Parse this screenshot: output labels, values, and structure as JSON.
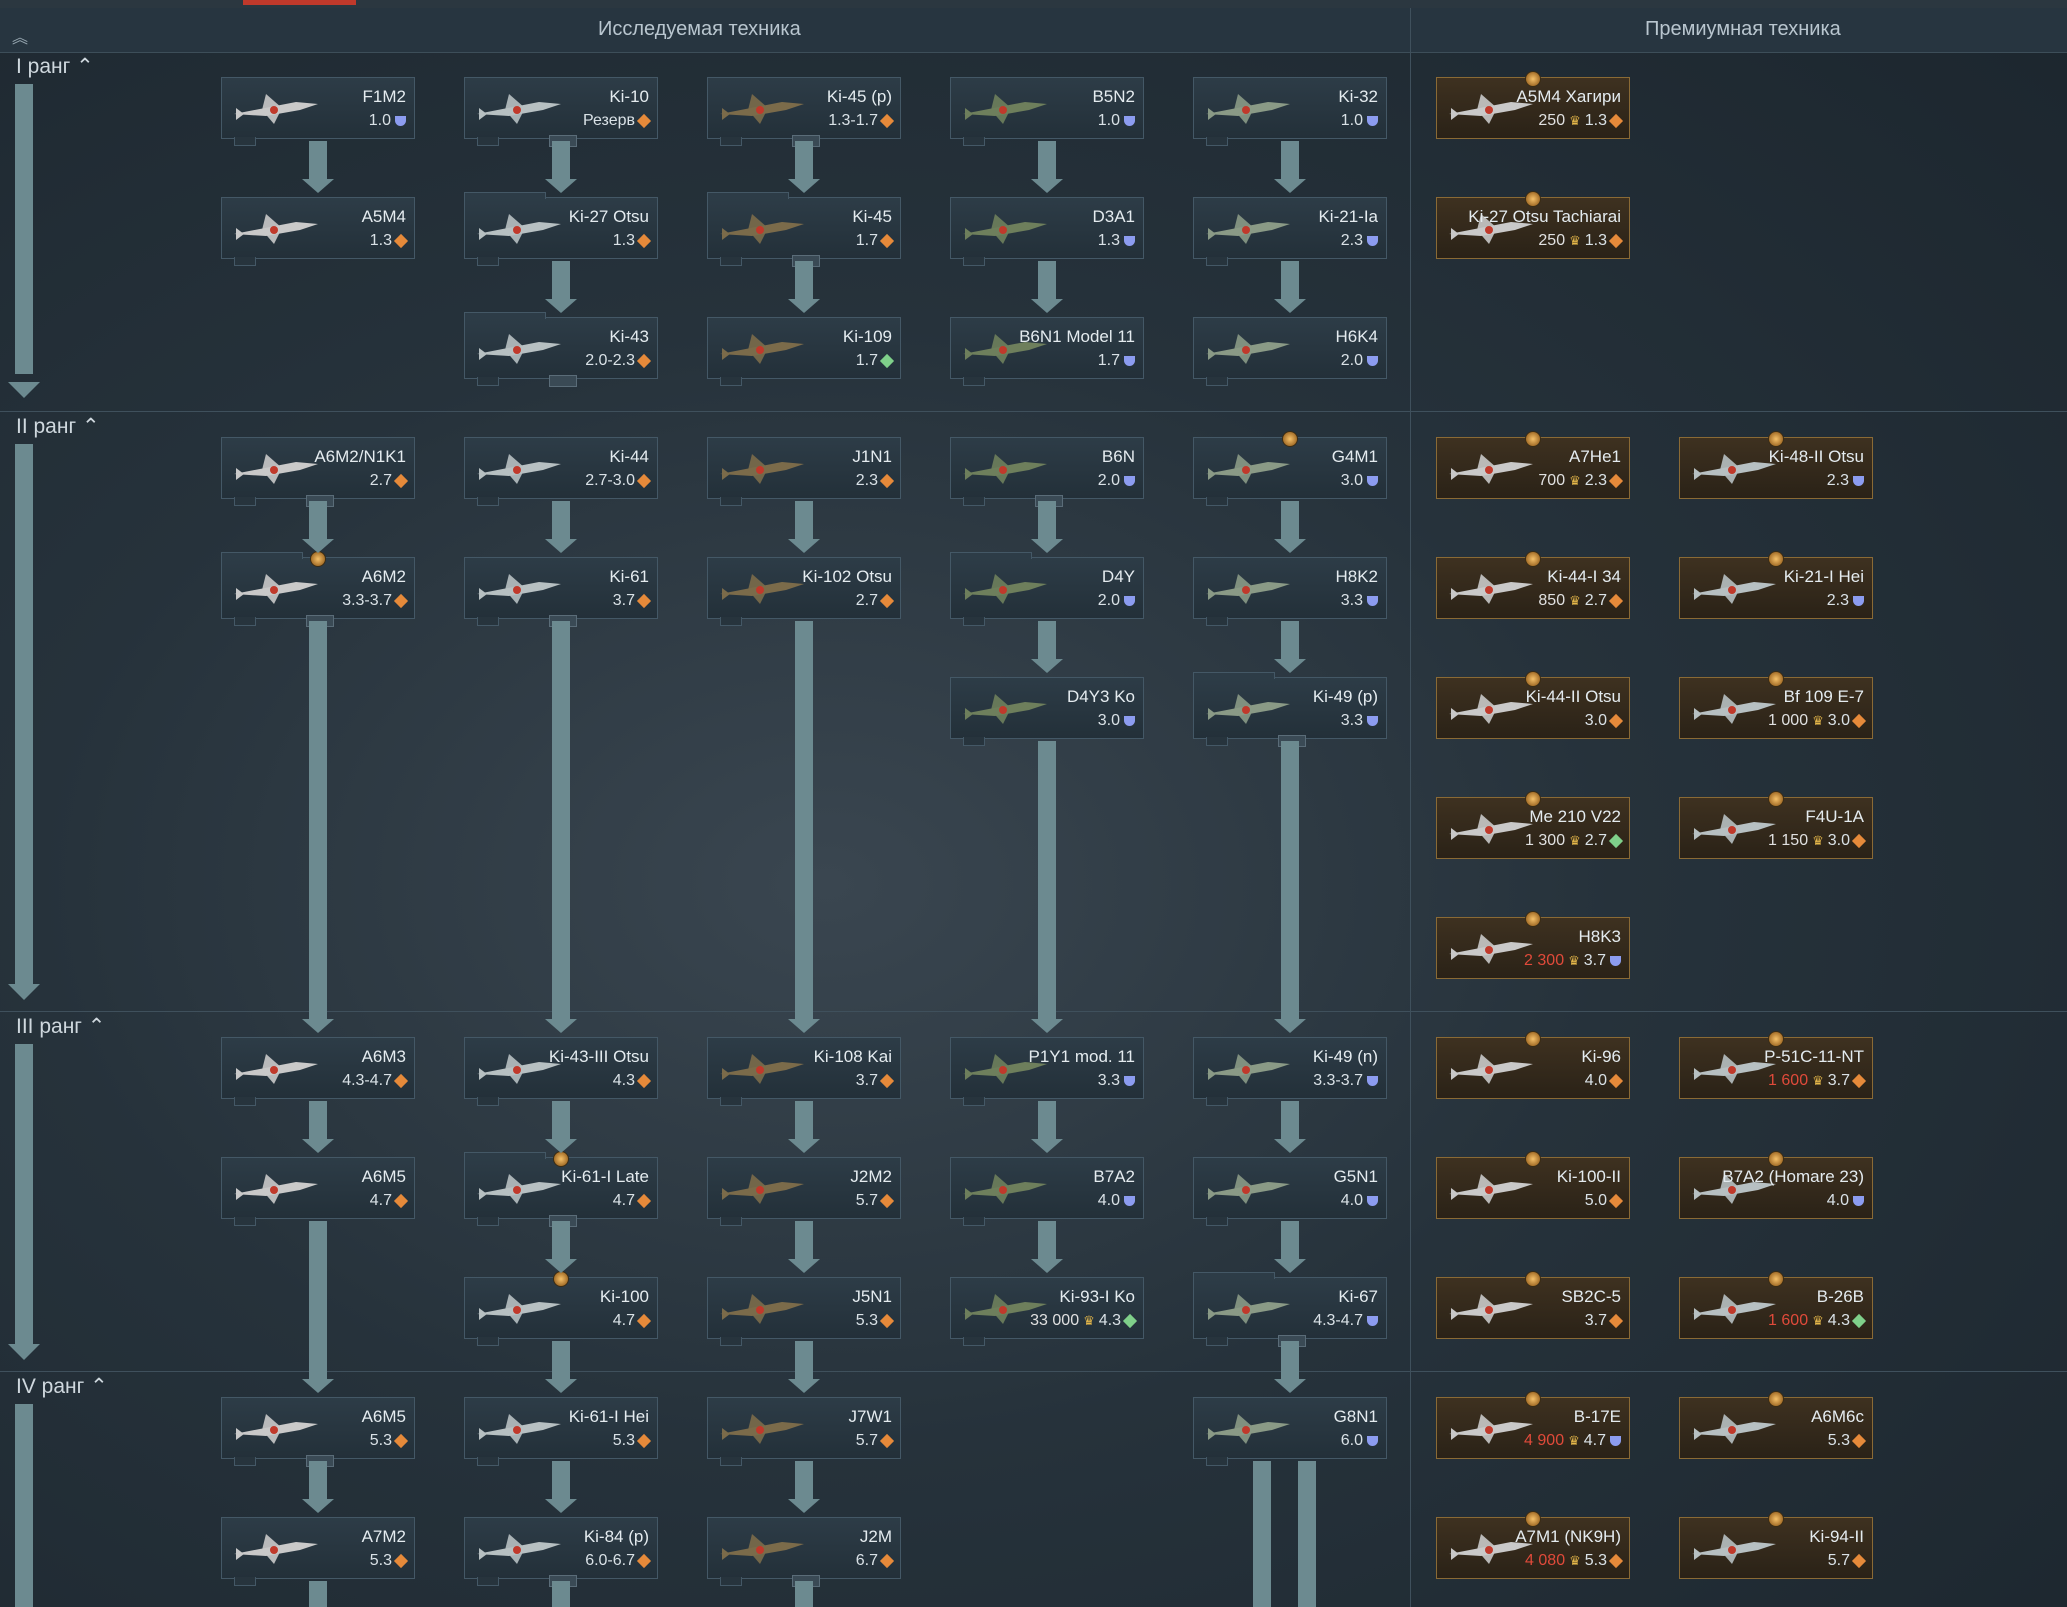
{
  "header": {
    "researchable_title": "Исследуемая техника",
    "premium_title": "Премиумная техника"
  },
  "ranks": [
    {
      "label": "I ранг"
    },
    {
      "label": "II ранг"
    },
    {
      "label": "III ранг"
    },
    {
      "label": "IV ранг"
    }
  ],
  "cards": {
    "r1": [
      {
        "name": "F1M2",
        "br": "1.0",
        "mark": "blue"
      },
      {
        "name": "Ki-10",
        "br": "Резерв",
        "mark": "air"
      },
      {
        "name": "Ki-45 (p)",
        "br": "1.3-1.7",
        "mark": "air"
      },
      {
        "name": "B5N2",
        "br": "1.0",
        "mark": "blue"
      },
      {
        "name": "Ki-32",
        "br": "1.0",
        "mark": "blue"
      },
      {
        "name": "A5M4",
        "br": "1.3",
        "mark": "air"
      },
      {
        "name": "Ki-27 Otsu",
        "br": "1.3",
        "mark": "air"
      },
      {
        "name": "Ki-45",
        "br": "1.7",
        "mark": "air"
      },
      {
        "name": "D3A1",
        "br": "1.3",
        "mark": "blue"
      },
      {
        "name": "Ki-21-Ia",
        "br": "2.3",
        "mark": "blue"
      },
      {
        "name": "Ki-43",
        "br": "2.0-2.3",
        "mark": "air"
      },
      {
        "name": "Ki-109",
        "br": "1.7",
        "mark": "green"
      },
      {
        "name": "B6N1 Model 11",
        "br": "1.7",
        "mark": "blue"
      },
      {
        "name": "H6K4",
        "br": "2.0",
        "mark": "blue"
      }
    ],
    "r1p": [
      {
        "name": "A5M4 Хагири",
        "cost": "250",
        "br": "1.3",
        "mark": "air"
      },
      {
        "name": "Ki-27 Otsu Tachiarai",
        "cost": "250",
        "br": "1.3",
        "mark": "air"
      }
    ],
    "r2": [
      {
        "name": "A6M2/N1K1",
        "br": "2.7",
        "mark": "air"
      },
      {
        "name": "Ki-44",
        "br": "2.7-3.0",
        "mark": "air"
      },
      {
        "name": "J1N1",
        "br": "2.3",
        "mark": "air"
      },
      {
        "name": "B6N",
        "br": "2.0",
        "mark": "blue"
      },
      {
        "name": "G4M1",
        "br": "3.0",
        "mark": "blue"
      },
      {
        "name": "A6M2",
        "br": "3.3-3.7",
        "mark": "air"
      },
      {
        "name": "Ki-61",
        "br": "3.7",
        "mark": "air"
      },
      {
        "name": "Ki-102 Otsu",
        "br": "2.7",
        "mark": "air"
      },
      {
        "name": "D4Y",
        "br": "2.0",
        "mark": "blue"
      },
      {
        "name": "H8K2",
        "br": "3.3",
        "mark": "blue"
      },
      {
        "name": "D4Y3 Ko",
        "br": "3.0",
        "mark": "blue"
      },
      {
        "name": "Ki-49 (p)",
        "br": "3.3",
        "mark": "blue"
      }
    ],
    "r2p": [
      {
        "name": "A7He1",
        "cost": "700",
        "br": "2.3",
        "mark": "air"
      },
      {
        "name": "Ki-48-II Otsu",
        "cost": "",
        "br": "2.3",
        "mark": "blue"
      },
      {
        "name": "Ki-44-I 34",
        "cost": "850",
        "br": "2.7",
        "mark": "air"
      },
      {
        "name": "Ki-21-I Hei",
        "cost": "",
        "br": "2.3",
        "mark": "blue"
      },
      {
        "name": "Ki-44-II Otsu",
        "cost": "",
        "br": "3.0",
        "mark": "air"
      },
      {
        "name": "Bf 109 E-7",
        "cost": "1 000",
        "br": "3.0",
        "mark": "air"
      },
      {
        "name": "Me 210 V22",
        "cost": "1 300",
        "br": "2.7",
        "mark": "green"
      },
      {
        "name": "F4U-1A",
        "cost": "1 150",
        "br": "3.0",
        "mark": "air"
      },
      {
        "name": "H8K3",
        "cost": "2 300",
        "br": "3.7",
        "mark": "blue",
        "red": true
      }
    ],
    "r3": [
      {
        "name": "A6M3",
        "br": "4.3-4.7",
        "mark": "air"
      },
      {
        "name": "Ki-43-III Otsu",
        "br": "4.3",
        "mark": "air"
      },
      {
        "name": "Ki-108 Kai",
        "br": "3.7",
        "mark": "air"
      },
      {
        "name": "P1Y1 mod. 11",
        "br": "3.3",
        "mark": "blue"
      },
      {
        "name": "Ki-49 (n)",
        "br": "3.3-3.7",
        "mark": "blue"
      },
      {
        "name": "A6M5",
        "br": "4.7",
        "mark": "air"
      },
      {
        "name": "Ki-61-I Late",
        "br": "4.7",
        "mark": "air"
      },
      {
        "name": "J2M2",
        "br": "5.7",
        "mark": "air"
      },
      {
        "name": "B7A2",
        "br": "4.0",
        "mark": "blue"
      },
      {
        "name": "G5N1",
        "br": "4.0",
        "mark": "blue"
      },
      {
        "name": "Ki-100",
        "br": "4.7",
        "mark": "air"
      },
      {
        "name": "J5N1",
        "br": "5.3",
        "mark": "air"
      },
      {
        "name": "Ki-93-I Ko",
        "cost": "33 000",
        "br": "4.3",
        "mark": "green"
      },
      {
        "name": "Ki-67",
        "br": "4.3-4.7",
        "mark": "blue"
      }
    ],
    "r3p": [
      {
        "name": "Ki-96",
        "cost": "",
        "br": "4.0",
        "mark": "air"
      },
      {
        "name": "P-51C-11-NT",
        "cost": "1 600",
        "br": "3.7",
        "mark": "air",
        "red": true
      },
      {
        "name": "Ki-100-II",
        "cost": "",
        "br": "5.0",
        "mark": "air"
      },
      {
        "name": "B7A2 (Homare 23)",
        "cost": "",
        "br": "4.0",
        "mark": "blue"
      },
      {
        "name": "SB2C-5",
        "cost": "",
        "br": "3.7",
        "mark": "air"
      },
      {
        "name": "B-26B",
        "cost": "1 600",
        "br": "4.3",
        "mark": "green",
        "red": true
      }
    ],
    "r4": [
      {
        "name": "A6M5",
        "br": "5.3",
        "mark": "air"
      },
      {
        "name": "Ki-61-I Hei",
        "br": "5.3",
        "mark": "air"
      },
      {
        "name": "J7W1",
        "br": "5.7",
        "mark": "air"
      },
      {
        "name": "G8N1",
        "br": "6.0",
        "mark": "blue"
      },
      {
        "name": "A7M2",
        "br": "5.3",
        "mark": "air"
      },
      {
        "name": "Ki-84 (p)",
        "br": "6.0-6.7",
        "mark": "air"
      },
      {
        "name": "J2M",
        "br": "6.7",
        "mark": "air"
      }
    ],
    "r4p": [
      {
        "name": "B-17E",
        "cost": "4 900",
        "br": "4.7",
        "mark": "blue",
        "red": true
      },
      {
        "name": "A6M6c",
        "cost": "",
        "br": "5.3",
        "mark": "air"
      },
      {
        "name": "A7M1 (NK9H)",
        "cost": "4 080",
        "br": "5.3",
        "mark": "air",
        "red": true
      },
      {
        "name": "Ki-94-II",
        "cost": "",
        "br": "5.7",
        "mark": "air"
      }
    ]
  },
  "colors": {
    "bg": "#1f2a33",
    "premium_border": "#8a6a35",
    "connector": "#6c8a90",
    "accent": "#c0392b"
  },
  "icons": [
    "collapse-up-icon",
    "chevron-up-icon",
    "plane-icon",
    "airplane-rp-icon",
    "bomber-rp-icon",
    "eagle-icon",
    "gold-crown-icon"
  ]
}
